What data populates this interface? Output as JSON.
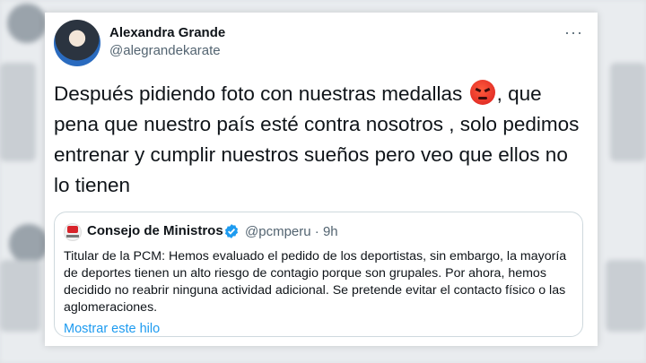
{
  "tweet": {
    "author_name": "Alexandra Grande",
    "author_handle": "@alegrandekarate",
    "more_icon": "···",
    "text_before_emoji": "Después pidiendo foto con nuestras medallas",
    "emoji": "angry-face",
    "text_after_emoji": ", que pena que nuestro país esté contra nosotros , solo pedimos entrenar y cumplir nuestros sueños pero veo que ellos no lo tienen"
  },
  "quoted_tweet": {
    "author_name": "Consejo de Ministros",
    "verified": true,
    "author_handle": "@pcmperu",
    "separator": "·",
    "time": "9h",
    "text": "Titular de la PCM: Hemos evaluado el pedido de los deportistas, sin embargo, la mayoría de deportes tienen un alto riesgo de contagio porque son grupales. Por ahora, hemos decidido no reabrir ninguna actividad adicional. Se pretende evitar el contacto físico o las aglomeraciones.",
    "show_thread_link": "Mostrar este hilo"
  },
  "colors": {
    "link": "#1d9bf0",
    "secondary_text": "#536471",
    "primary_text": "#0f1419"
  }
}
